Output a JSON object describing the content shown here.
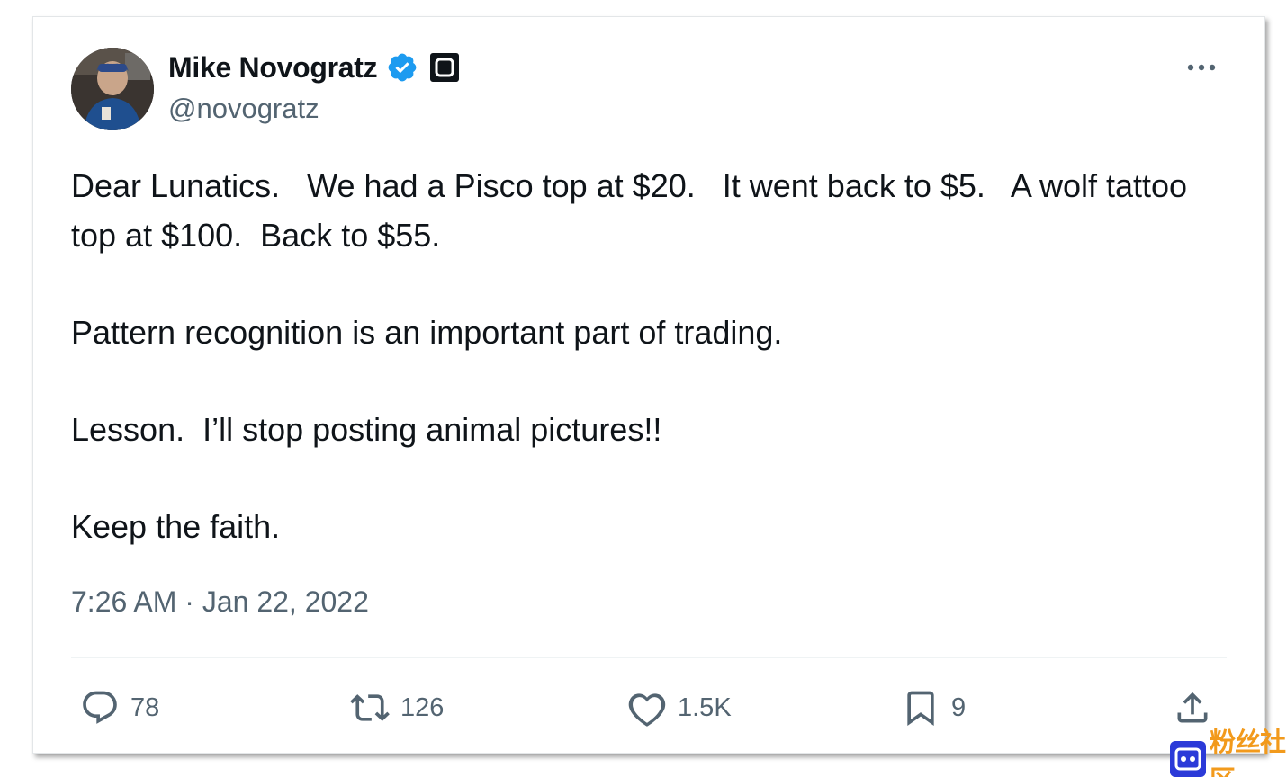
{
  "tweet": {
    "author_name": "Mike Novogratz",
    "author_handle": "@novogratz",
    "paragraphs": [
      "Dear Lunatics.   We had a Pisco top at $20.   It went back to $5.   A wolf tattoo top at $100.  Back to $55.",
      "Pattern recognition is an important part of trading.",
      "Lesson.  I’ll stop posting animal pictures!!",
      "Keep the faith."
    ],
    "timestamp": "7:26 AM · Jan 22, 2022",
    "actions": {
      "replies": "78",
      "reposts": "126",
      "likes": "1.5K",
      "bookmarks": "9"
    }
  },
  "icons": {
    "verified": "verified-badge-icon",
    "affiliation": "affiliation-badge-icon",
    "more": "more-options-icon",
    "reply": "reply-icon",
    "repost": "repost-icon",
    "like": "heart-icon",
    "bookmark": "bookmark-icon",
    "share": "share-icon"
  },
  "colors": {
    "verified_blue": "#1d9bf0",
    "secondary_text": "#536471",
    "primary_text": "#0f1419",
    "watermark_blue": "#2b3ad8",
    "watermark_orange": "#f29a1c"
  },
  "watermark": {
    "text": "粉丝社区"
  }
}
